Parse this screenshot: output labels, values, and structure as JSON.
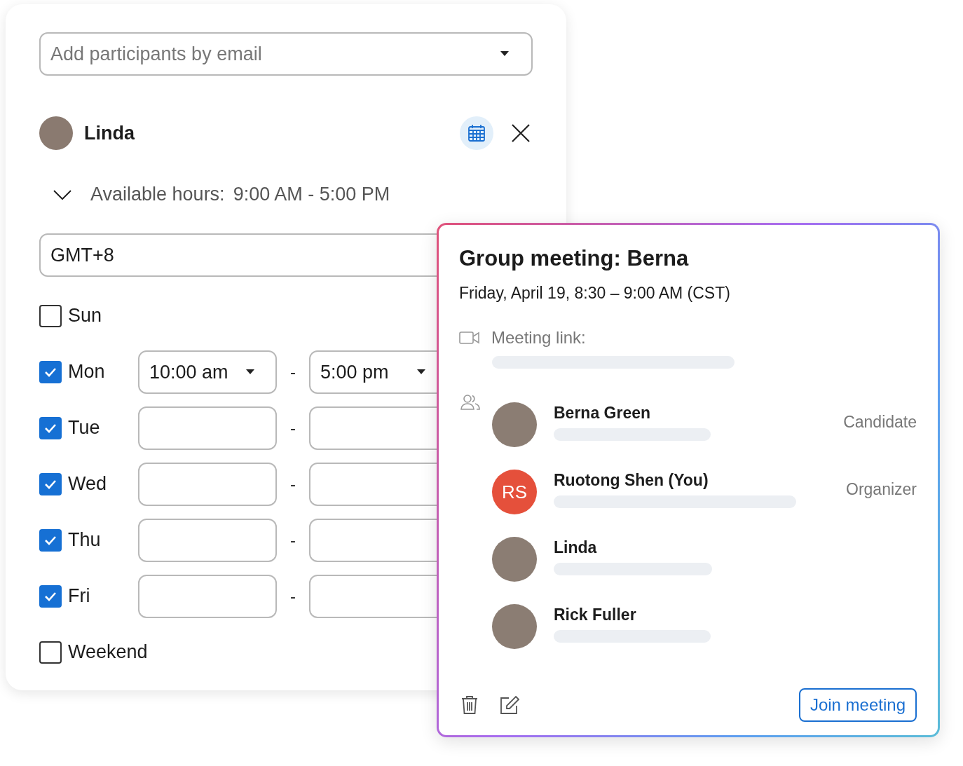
{
  "participants_field": {
    "placeholder": "Add participants by email"
  },
  "participant": {
    "name": "Linda"
  },
  "available_hours": {
    "label": "Available hours:",
    "value": "9:00 AM - 5:00 PM"
  },
  "timezone": {
    "value": "GMT+8"
  },
  "days": [
    {
      "kind": "plain",
      "label": "Sun",
      "checked": false
    },
    {
      "kind": "range",
      "label": "Mon",
      "checked": true,
      "start": "10:00 am",
      "end": "5:00 pm",
      "separator": "-"
    },
    {
      "kind": "range",
      "label": "Tue",
      "checked": true,
      "separator": "-"
    },
    {
      "kind": "range",
      "label": "Wed",
      "checked": true,
      "separator": "-"
    },
    {
      "kind": "range",
      "label": "Thu",
      "checked": true,
      "separator": "-"
    },
    {
      "kind": "range",
      "label": "Fri",
      "checked": true,
      "separator": "-"
    },
    {
      "kind": "plain",
      "label": "Weekend",
      "checked": false
    }
  ],
  "meeting_card": {
    "title": "Group meeting: Berna",
    "date": "Friday, April 19, 8:30 – 9:00 AM (CST)",
    "link_label": "Meeting link:",
    "attendees": [
      {
        "kind": "photo",
        "name": "Berna Green",
        "role": "Candidate"
      },
      {
        "kind": "initials",
        "initials": "RS",
        "name": "Ruotong Shen (You)",
        "role": "Organizer"
      },
      {
        "kind": "photo",
        "name": "Linda"
      },
      {
        "kind": "photo",
        "name": "Rick Fuller"
      }
    ],
    "join_button": "Join meeting"
  }
}
